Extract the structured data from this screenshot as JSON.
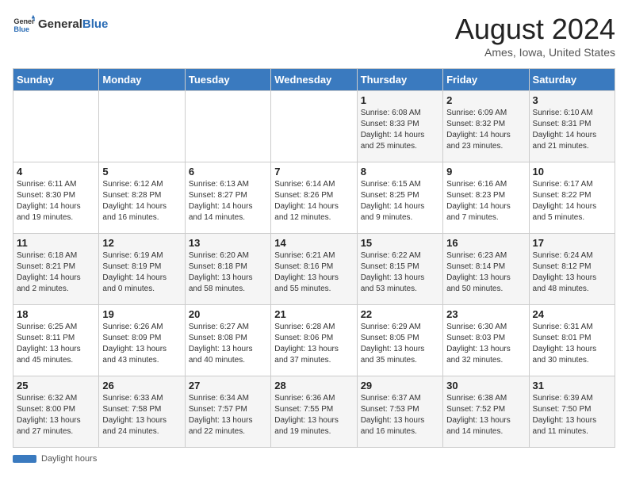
{
  "header": {
    "logo_general": "General",
    "logo_blue": "Blue",
    "month_title": "August 2024",
    "location": "Ames, Iowa, United States"
  },
  "footer": {
    "label": "Daylight hours"
  },
  "days_of_week": [
    "Sunday",
    "Monday",
    "Tuesday",
    "Wednesday",
    "Thursday",
    "Friday",
    "Saturday"
  ],
  "weeks": [
    {
      "days": [
        {
          "num": "",
          "info": ""
        },
        {
          "num": "",
          "info": ""
        },
        {
          "num": "",
          "info": ""
        },
        {
          "num": "",
          "info": ""
        },
        {
          "num": "1",
          "info": "Sunrise: 6:08 AM\nSunset: 8:33 PM\nDaylight: 14 hours and 25 minutes."
        },
        {
          "num": "2",
          "info": "Sunrise: 6:09 AM\nSunset: 8:32 PM\nDaylight: 14 hours and 23 minutes."
        },
        {
          "num": "3",
          "info": "Sunrise: 6:10 AM\nSunset: 8:31 PM\nDaylight: 14 hours and 21 minutes."
        }
      ]
    },
    {
      "days": [
        {
          "num": "4",
          "info": "Sunrise: 6:11 AM\nSunset: 8:30 PM\nDaylight: 14 hours and 19 minutes."
        },
        {
          "num": "5",
          "info": "Sunrise: 6:12 AM\nSunset: 8:28 PM\nDaylight: 14 hours and 16 minutes."
        },
        {
          "num": "6",
          "info": "Sunrise: 6:13 AM\nSunset: 8:27 PM\nDaylight: 14 hours and 14 minutes."
        },
        {
          "num": "7",
          "info": "Sunrise: 6:14 AM\nSunset: 8:26 PM\nDaylight: 14 hours and 12 minutes."
        },
        {
          "num": "8",
          "info": "Sunrise: 6:15 AM\nSunset: 8:25 PM\nDaylight: 14 hours and 9 minutes."
        },
        {
          "num": "9",
          "info": "Sunrise: 6:16 AM\nSunset: 8:23 PM\nDaylight: 14 hours and 7 minutes."
        },
        {
          "num": "10",
          "info": "Sunrise: 6:17 AM\nSunset: 8:22 PM\nDaylight: 14 hours and 5 minutes."
        }
      ]
    },
    {
      "days": [
        {
          "num": "11",
          "info": "Sunrise: 6:18 AM\nSunset: 8:21 PM\nDaylight: 14 hours and 2 minutes."
        },
        {
          "num": "12",
          "info": "Sunrise: 6:19 AM\nSunset: 8:19 PM\nDaylight: 14 hours and 0 minutes."
        },
        {
          "num": "13",
          "info": "Sunrise: 6:20 AM\nSunset: 8:18 PM\nDaylight: 13 hours and 58 minutes."
        },
        {
          "num": "14",
          "info": "Sunrise: 6:21 AM\nSunset: 8:16 PM\nDaylight: 13 hours and 55 minutes."
        },
        {
          "num": "15",
          "info": "Sunrise: 6:22 AM\nSunset: 8:15 PM\nDaylight: 13 hours and 53 minutes."
        },
        {
          "num": "16",
          "info": "Sunrise: 6:23 AM\nSunset: 8:14 PM\nDaylight: 13 hours and 50 minutes."
        },
        {
          "num": "17",
          "info": "Sunrise: 6:24 AM\nSunset: 8:12 PM\nDaylight: 13 hours and 48 minutes."
        }
      ]
    },
    {
      "days": [
        {
          "num": "18",
          "info": "Sunrise: 6:25 AM\nSunset: 8:11 PM\nDaylight: 13 hours and 45 minutes."
        },
        {
          "num": "19",
          "info": "Sunrise: 6:26 AM\nSunset: 8:09 PM\nDaylight: 13 hours and 43 minutes."
        },
        {
          "num": "20",
          "info": "Sunrise: 6:27 AM\nSunset: 8:08 PM\nDaylight: 13 hours and 40 minutes."
        },
        {
          "num": "21",
          "info": "Sunrise: 6:28 AM\nSunset: 8:06 PM\nDaylight: 13 hours and 37 minutes."
        },
        {
          "num": "22",
          "info": "Sunrise: 6:29 AM\nSunset: 8:05 PM\nDaylight: 13 hours and 35 minutes."
        },
        {
          "num": "23",
          "info": "Sunrise: 6:30 AM\nSunset: 8:03 PM\nDaylight: 13 hours and 32 minutes."
        },
        {
          "num": "24",
          "info": "Sunrise: 6:31 AM\nSunset: 8:01 PM\nDaylight: 13 hours and 30 minutes."
        }
      ]
    },
    {
      "days": [
        {
          "num": "25",
          "info": "Sunrise: 6:32 AM\nSunset: 8:00 PM\nDaylight: 13 hours and 27 minutes."
        },
        {
          "num": "26",
          "info": "Sunrise: 6:33 AM\nSunset: 7:58 PM\nDaylight: 13 hours and 24 minutes."
        },
        {
          "num": "27",
          "info": "Sunrise: 6:34 AM\nSunset: 7:57 PM\nDaylight: 13 hours and 22 minutes."
        },
        {
          "num": "28",
          "info": "Sunrise: 6:36 AM\nSunset: 7:55 PM\nDaylight: 13 hours and 19 minutes."
        },
        {
          "num": "29",
          "info": "Sunrise: 6:37 AM\nSunset: 7:53 PM\nDaylight: 13 hours and 16 minutes."
        },
        {
          "num": "30",
          "info": "Sunrise: 6:38 AM\nSunset: 7:52 PM\nDaylight: 13 hours and 14 minutes."
        },
        {
          "num": "31",
          "info": "Sunrise: 6:39 AM\nSunset: 7:50 PM\nDaylight: 13 hours and 11 minutes."
        }
      ]
    }
  ]
}
